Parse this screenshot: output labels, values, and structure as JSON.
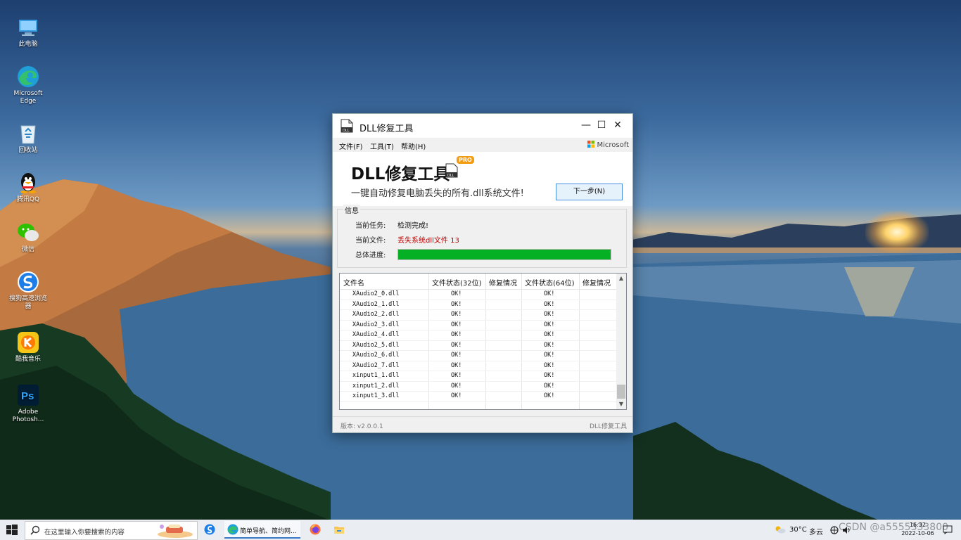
{
  "desktop": {
    "icons": [
      {
        "label": "此电脑"
      },
      {
        "label": "Microsoft Edge"
      },
      {
        "label": "回收站"
      },
      {
        "label": "腾讯QQ"
      },
      {
        "label": "微信"
      },
      {
        "label": "搜狗高速浏览器"
      },
      {
        "label": "酷我音乐"
      },
      {
        "label": "Adobe Photosh..."
      }
    ]
  },
  "window": {
    "title": "DLL修复工具",
    "icon": "dll-file-icon",
    "controls": {
      "minimize": "—",
      "maximize": "☐",
      "close": "✕"
    },
    "menu": [
      {
        "label": "文件(F)"
      },
      {
        "label": "工具(T)"
      },
      {
        "label": "帮助(H)"
      }
    ],
    "menu_brand": "Microsoft",
    "header": {
      "brand": "DLL修复工具",
      "badge": "PRO",
      "slogan": "一键自动修复电脑丢失的所有.dll系统文件!",
      "next_button": "下一步(N)"
    },
    "info": {
      "legend": "信息",
      "task_label": "当前任务:",
      "task_value": "检测完成!",
      "file_label": "当前文件:",
      "file_value": "丢失系统dll文件 13",
      "progress_label": "总体进度:",
      "progress_percent": 100,
      "progress_color": "#06b025",
      "error_color": "#c00000"
    },
    "table": {
      "columns": [
        "文件名",
        "文件状态(32位)",
        "修复情况",
        "文件状态(64位)",
        "修复情况"
      ],
      "rows": [
        {
          "name": "XAudio2_0.dll",
          "s32": "OK!",
          "fix32": "",
          "s64": "OK!",
          "fix64": ""
        },
        {
          "name": "XAudio2_1.dll",
          "s32": "OK!",
          "fix32": "",
          "s64": "OK!",
          "fix64": ""
        },
        {
          "name": "XAudio2_2.dll",
          "s32": "OK!",
          "fix32": "",
          "s64": "OK!",
          "fix64": ""
        },
        {
          "name": "XAudio2_3.dll",
          "s32": "OK!",
          "fix32": "",
          "s64": "OK!",
          "fix64": ""
        },
        {
          "name": "XAudio2_4.dll",
          "s32": "OK!",
          "fix32": "",
          "s64": "OK!",
          "fix64": ""
        },
        {
          "name": "XAudio2_5.dll",
          "s32": "OK!",
          "fix32": "",
          "s64": "OK!",
          "fix64": ""
        },
        {
          "name": "XAudio2_6.dll",
          "s32": "OK!",
          "fix32": "",
          "s64": "OK!",
          "fix64": ""
        },
        {
          "name": "XAudio2_7.dll",
          "s32": "OK!",
          "fix32": "",
          "s64": "OK!",
          "fix64": ""
        },
        {
          "name": "xinput1_1.dll",
          "s32": "OK!",
          "fix32": "",
          "s64": "OK!",
          "fix64": ""
        },
        {
          "name": "xinput1_2.dll",
          "s32": "OK!",
          "fix32": "",
          "s64": "OK!",
          "fix64": ""
        },
        {
          "name": "xinput1_3.dll",
          "s32": "OK!",
          "fix32": "",
          "s64": "OK!",
          "fix64": ""
        }
      ]
    },
    "status": {
      "version": "版本: v2.0.0.1",
      "app_name": "DLL修复工具"
    }
  },
  "taskbar": {
    "search_placeholder": "在这里输入你要搜索的内容",
    "items": [
      {
        "label": "",
        "icon": "sogou-browser-icon"
      },
      {
        "label": "简单导航、简约网...",
        "icon": "edge-icon"
      },
      {
        "label": "",
        "icon": "firefox-icon"
      },
      {
        "label": "",
        "icon": "file-explorer-icon"
      }
    ],
    "weather_temp": "30°C",
    "weather_text": "多云",
    "clock_time": "16:32",
    "clock_date": "2022-10-06",
    "watermark": "CSDN @a5555333800"
  }
}
